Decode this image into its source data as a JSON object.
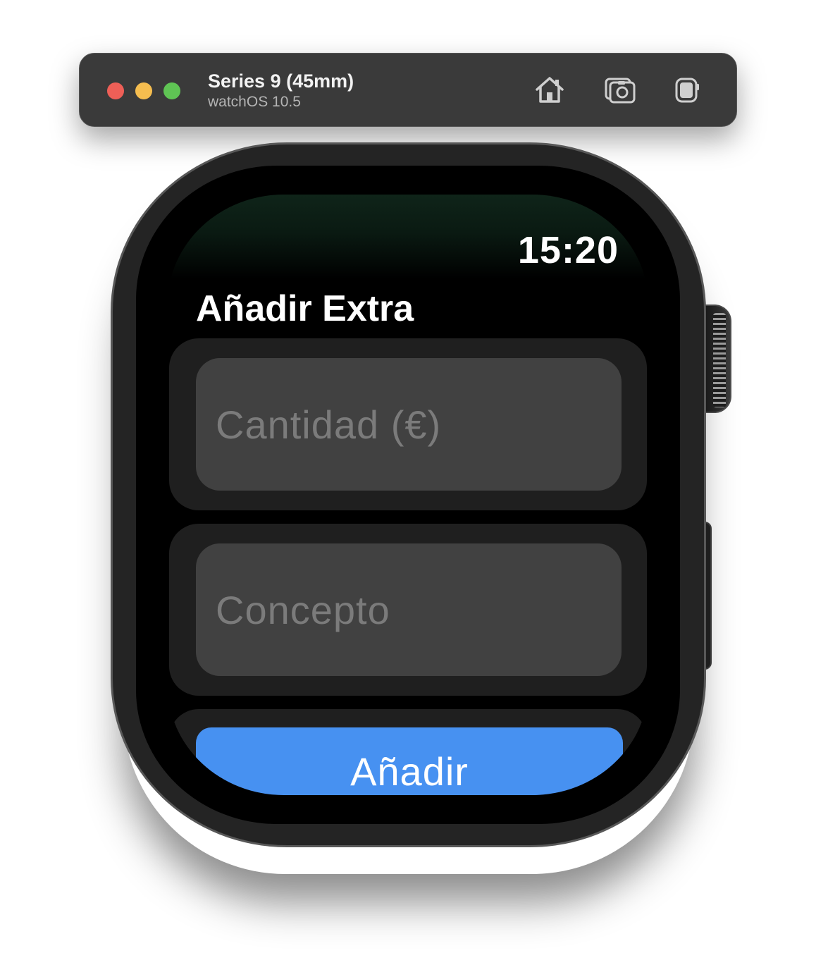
{
  "simulator": {
    "device_name": "Series 9 (45mm)",
    "os_version": "watchOS 10.5",
    "traffic_lights": {
      "close_color": "#ee5f57",
      "minimize_color": "#f5bd4f",
      "zoom_color": "#5fc454"
    },
    "toolbar_icons": [
      "home-icon",
      "screenshot-icon",
      "rotate-icon"
    ]
  },
  "watch": {
    "status_time": "15:20",
    "nav_title": "Añadir Extra",
    "fields": {
      "amount_placeholder": "Cantidad (€)",
      "concept_placeholder": "Concepto"
    },
    "add_button_label": "Añadir",
    "accent_color": "#4791f1"
  }
}
